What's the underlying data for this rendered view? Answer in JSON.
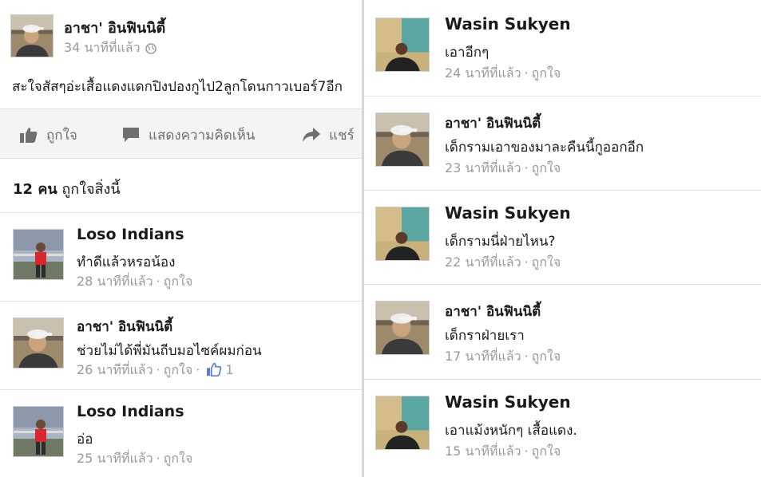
{
  "post": {
    "author": "อาชา' อินฟินนิตี้",
    "time": "34 นาทีที่แล้ว",
    "text": "สะใจสัสๆอ่ะเสื้อแดงแดกปิงปองกูไป2ลูกโดนกาวเบอร์7อีก",
    "privacy_icon": "globe-icon"
  },
  "actions": {
    "like": "ถูกใจ",
    "comment": "แสดงความคิดเห็น",
    "share": "แชร์"
  },
  "likes_summary": {
    "count": "12 คน",
    "text": "ถูกใจสิ่งนี้"
  },
  "left_comments": [
    {
      "author": "Loso Indians",
      "text": "ทำดีแล้วหรอน้อง",
      "time": "28 นาทีที่แล้ว",
      "like": "ถูกใจ",
      "likes": ""
    },
    {
      "author": "อาชา' อินฟินนิตี้",
      "text": "ช่วยไม่ได้พี่มันถีบมอไซค์ผมก่อน",
      "time": "26 นาทีที่แล้ว",
      "like": "ถูกใจ",
      "likes": "1"
    },
    {
      "author": "Loso Indians",
      "text": "อ่อ",
      "time": "25 นาทีที่แล้ว",
      "like": "ถูกใจ",
      "likes": ""
    }
  ],
  "right_comments": [
    {
      "author": "Wasin Sukyen",
      "text": "เอาอีกๆ",
      "time": "24 นาทีที่แล้ว",
      "like": "ถูกใจ"
    },
    {
      "author": "อาชา' อินฟินนิตี้",
      "text": "เด็กรามเอาของมาละคืนนี้กูออกอีก",
      "time": "23 นาทีที่แล้ว",
      "like": "ถูกใจ"
    },
    {
      "author": "Wasin Sukyen",
      "text": "เด็กรามนี่ฝ่ายไหน?",
      "time": "22 นาทีที่แล้ว",
      "like": "ถูกใจ"
    },
    {
      "author": "อาชา' อินฟินนิตี้",
      "text": "เด็กราฝ่ายเรา",
      "time": "17 นาทีที่แล้ว",
      "like": "ถูกใจ"
    },
    {
      "author": "Wasin Sukyen",
      "text": "เอาแม้งหนักๆ เสื้อแดง.",
      "time": "15 นาทีที่แล้ว",
      "like": "ถูกใจ"
    }
  ],
  "separator": "·",
  "colors": {
    "meta_gray": "#9a9a9a",
    "action_gray": "#6f6f6f",
    "like_blue": "#5b7bd5"
  }
}
